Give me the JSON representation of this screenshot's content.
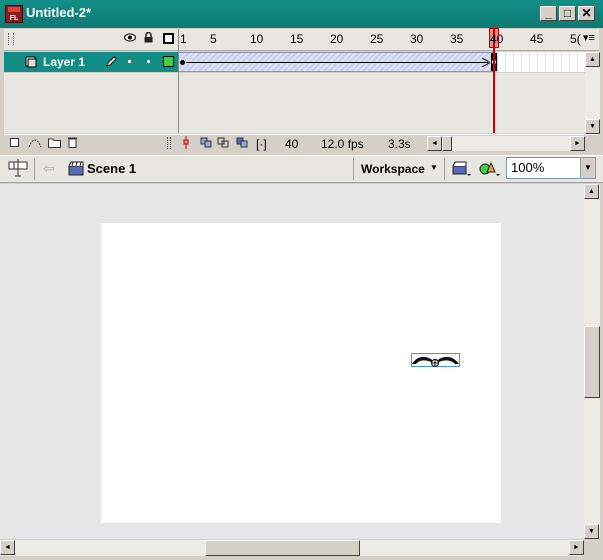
{
  "window": {
    "title": "Untitled-2*",
    "app_icon_text": "FL",
    "controls": {
      "minimize": "_",
      "maximize": "□",
      "close": "✕"
    }
  },
  "timeline": {
    "ruler": [
      "1",
      "5",
      "10",
      "15",
      "20",
      "25",
      "30",
      "35",
      "40",
      "45",
      "5("
    ],
    "layer": {
      "name": "Layer 1"
    },
    "status": {
      "current_frame": "40",
      "frame_rate": "12.0 fps",
      "elapsed": "3.3s"
    },
    "menu_glyph": "▾≡"
  },
  "editbar": {
    "scene": "Scene 1",
    "workspace_label": "Workspace",
    "zoom": "100%"
  },
  "colors": {
    "accent": "#128d86",
    "playhead": "#cc0000",
    "selection": "#3aa0c8"
  }
}
